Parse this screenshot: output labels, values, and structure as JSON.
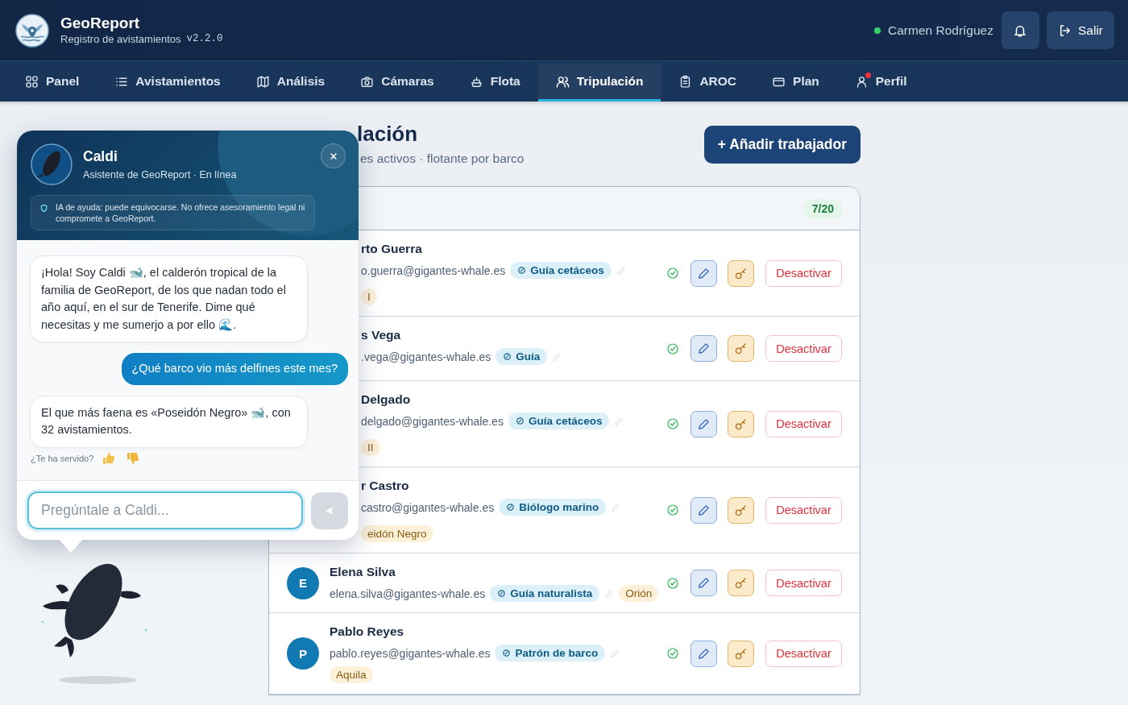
{
  "app": {
    "title": "GeoReport",
    "subtitle": "Registro de avistamientos",
    "version": "v2.2.0"
  },
  "user": {
    "name": "Carmen Rodríguez",
    "online": true
  },
  "logout_button": {
    "label": "Salir"
  },
  "nav": [
    {
      "kind": "grid",
      "label": "Panel",
      "selected": false,
      "alert": false
    },
    {
      "kind": "list",
      "label": "Avistamientos",
      "selected": false,
      "alert": false
    },
    {
      "kind": "map",
      "label": "Análisis",
      "selected": false,
      "alert": false
    },
    {
      "kind": "camera",
      "label": "Cámaras",
      "selected": false,
      "alert": false
    },
    {
      "kind": "ship",
      "label": "Flota",
      "selected": false,
      "alert": false
    },
    {
      "kind": "users",
      "label": "Tripulación",
      "selected": true,
      "alert": false
    },
    {
      "kind": "clipboard",
      "label": "AROC",
      "selected": false,
      "alert": false
    },
    {
      "kind": "card",
      "label": "Plan",
      "selected": false,
      "alert": false
    },
    {
      "kind": "user",
      "label": "Perfil",
      "selected": false,
      "alert": true
    }
  ],
  "page": {
    "title": "lación",
    "subtitle": "es activos · flotante por barco",
    "add_button": "+ Añadir trabajador"
  },
  "crew": {
    "count": "7/20",
    "rows": [
      {
        "name": "rto Guerra",
        "email": "o.guerra@gigantes-whale.es",
        "role": "Guía cetáceos",
        "boats": [
          "I"
        ],
        "active": true,
        "action": "Desactivar"
      },
      {
        "name": "s Vega",
        "email": ".vega@gigantes-whale.es",
        "role": "Guía",
        "boats": [],
        "active": true,
        "action": "Desactivar"
      },
      {
        "name": "Delgado",
        "email": "delgado@gigantes-whale.es",
        "role": "Guía cetáceos",
        "boats": [
          "II"
        ],
        "active": true,
        "action": "Desactivar"
      },
      {
        "name": "r Castro",
        "email": "castro@gigantes-whale.es",
        "role": "Biólogo marino",
        "boats": [
          "eidón Negro"
        ],
        "active": true,
        "action": "Desactivar"
      },
      {
        "avatar": "E",
        "name": "Elena Silva",
        "email": "elena.silva@gigantes-whale.es",
        "role": "Guía naturalista",
        "boats": [
          "Orión"
        ],
        "active": true,
        "action": "Desactivar"
      },
      {
        "avatar": "P",
        "name": "Pablo Reyes",
        "email": "pablo.reyes@gigantes-whale.es",
        "role": "Patrón de barco",
        "boats": [
          "Aquila"
        ],
        "active": true,
        "action": "Desactivar"
      }
    ]
  },
  "chat": {
    "name": "Caldi",
    "status": "Asistente de GeoReport · En línea",
    "disclaimer": "IA de ayuda: puede equivocarse. No ofrece asesoramiento legal ni compromete a GeoReport.",
    "messages": [
      {
        "kind": "bot",
        "text": "¡Hola! Soy Caldi 🐋, el calderón tropical de la familia de GeoReport, de los que nadan todo el año aquí, en el sur de Tenerife. Dime qué necesitas y me sumerjo a por ello 🌊."
      },
      {
        "kind": "user",
        "text": "¿Qué barco vio más delfines este mes?"
      },
      {
        "kind": "bot",
        "text": "El que más faena es «Poseidón Negro» 🐋, con 32 avistamientos."
      }
    ],
    "feedback": "¿Te ha servido?",
    "placeholder": "Pregúntale a Caldi..."
  }
}
